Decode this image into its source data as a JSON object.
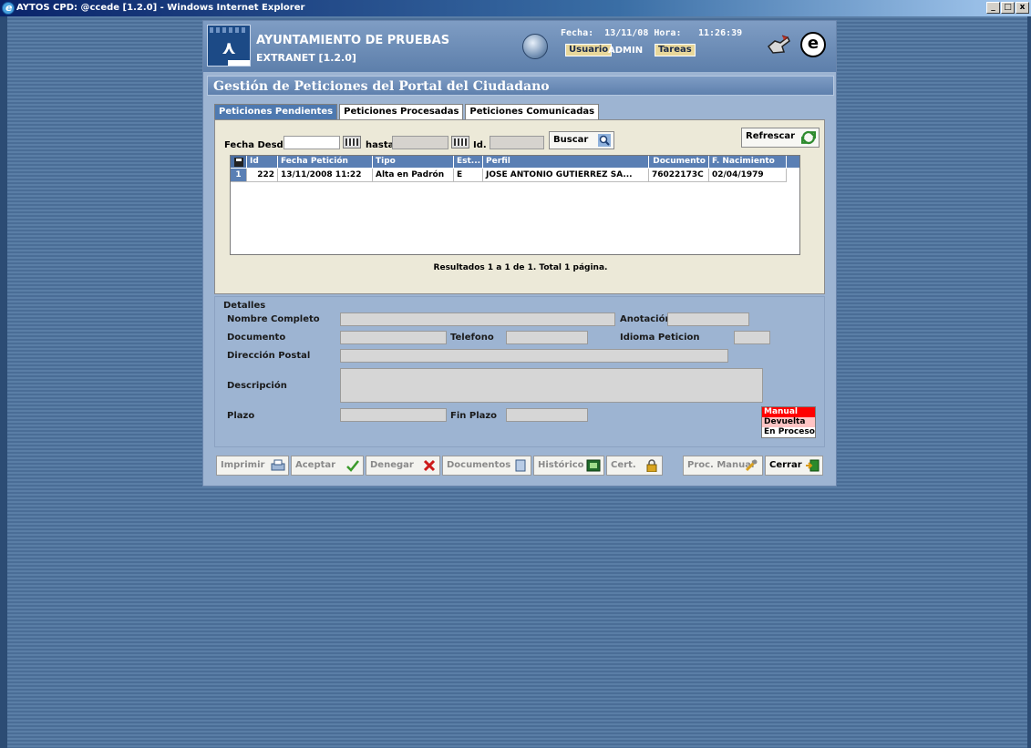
{
  "window": {
    "title": "AYTOS CPD: @ccede [1.2.0] - Windows Internet Explorer",
    "buttons": [
      "_",
      "□",
      "x"
    ]
  },
  "header": {
    "org_name": "AYUNTAMIENTO DE PRUEBAS",
    "app_version": "EXTRANET [1.2.0]",
    "fecha_label": "Fecha:",
    "fecha_value": "13/11/08",
    "hora_label": "Hora:",
    "hora_value": "11:26:39",
    "usuario_label": "Usuario",
    "usuario_value": "ADMIN",
    "tareas_label": "Tareas"
  },
  "page_title": "Gestión de Peticiones del Portal del Ciudadano",
  "tabs": [
    {
      "label": "Peticiones Pendientes",
      "active": true
    },
    {
      "label": "Peticiones Procesadas",
      "active": false
    },
    {
      "label": "Peticiones Comunicadas",
      "active": false
    }
  ],
  "filters": {
    "fecha_desde_label": "Fecha Desde",
    "hasta_label": "hasta",
    "id_label": "Id.",
    "buscar_label": "Buscar",
    "refrescar_label": "Refrescar"
  },
  "table": {
    "columns": [
      "Id",
      "Fecha Petición",
      "Tipo",
      "Est...",
      "Perfil",
      "Documento",
      "F. Nacimiento"
    ],
    "rows": [
      {
        "num": "1",
        "id": "222",
        "fecha": "13/11/2008 11:22",
        "tipo": "Alta en Padrón",
        "estado": "E",
        "perfil": "JOSE ANTONIO GUTIERREZ SA...",
        "documento": "76022173C",
        "nacimiento": "02/04/1979"
      }
    ]
  },
  "results_text": "Resultados 1 a 1 de 1. Total 1 página.",
  "details": {
    "section_label": "Detalles",
    "nombre_label": "Nombre Completo",
    "anotacion_label": "Anotación",
    "documento_label": "Documento",
    "telefono_label": "Telefono",
    "idioma_label": "Idioma Peticion",
    "direccion_label": "Dirección Postal",
    "descripcion_label": "Descripción",
    "plazo_label": "Plazo",
    "fin_plazo_label": "Fin Plazo"
  },
  "legend": [
    {
      "label": "Manual",
      "color": "#ff0000",
      "text_color": "#ffffff"
    },
    {
      "label": "Devuelta",
      "color": "#ffc4c4",
      "text_color": "#000000"
    },
    {
      "label": "En Proceso",
      "color": "#ffffff",
      "text_color": "#000000"
    }
  ],
  "actions": {
    "imprimir": "Imprimir",
    "aceptar": "Aceptar",
    "denegar": "Denegar",
    "documentos": "Documentos",
    "historico": "Histórico",
    "cert": "Cert.",
    "proc_manual": "Proc. Manual",
    "cerrar": "Cerrar"
  }
}
